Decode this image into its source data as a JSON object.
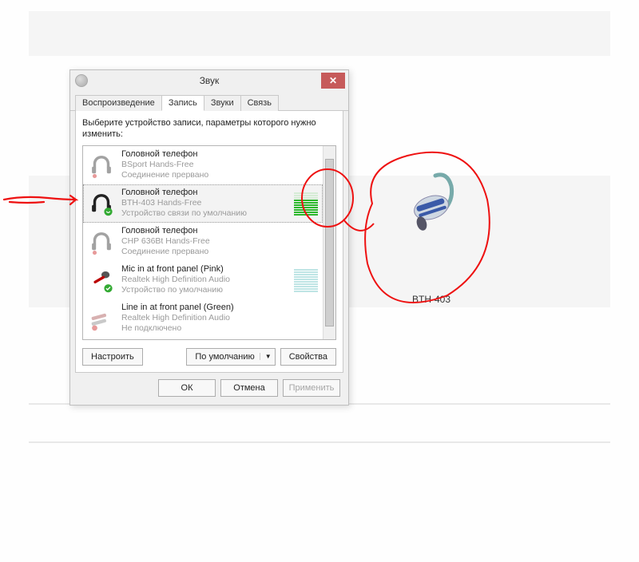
{
  "dialog": {
    "title": "Звук",
    "tabs": [
      "Воспроизведение",
      "Запись",
      "Звуки",
      "Связь"
    ],
    "active_tab_index": 1,
    "instruction": "Выберите устройство записи, параметры которого нужно изменить:",
    "devices": [
      {
        "name": "Головной телефон",
        "sub1": "BSport Hands-Free",
        "sub2": "Соединение прервано",
        "icon": "headset",
        "dimmed": true,
        "level": 0
      },
      {
        "name": "Головной телефон",
        "sub1": "BTH-403 Hands-Free",
        "sub2": "Устройство связи по умолчанию",
        "icon": "headset-green",
        "dimmed": false,
        "level": 7,
        "selected": true
      },
      {
        "name": "Головной телефон",
        "sub1": "CHP 636Bt Hands-Free",
        "sub2": "Соединение прервано",
        "icon": "headset",
        "dimmed": true,
        "level": 0
      },
      {
        "name": "Mic in at front panel (Pink)",
        "sub1": "Realtek High Definition Audio",
        "sub2": "Устройство по умолчанию",
        "icon": "mic",
        "dimmed": false,
        "level": 2
      },
      {
        "name": "Line in at front panel (Green)",
        "sub1": "Realtek High Definition Audio",
        "sub2": "Не подключено",
        "icon": "jack",
        "dimmed": true,
        "level": 0
      }
    ],
    "buttons": {
      "configure": "Настроить",
      "set_default": "По умолчанию",
      "properties": "Свойства",
      "ok": "ОК",
      "cancel": "Отмена",
      "apply": "Применить"
    }
  },
  "bt_device_label": "BTH-403"
}
